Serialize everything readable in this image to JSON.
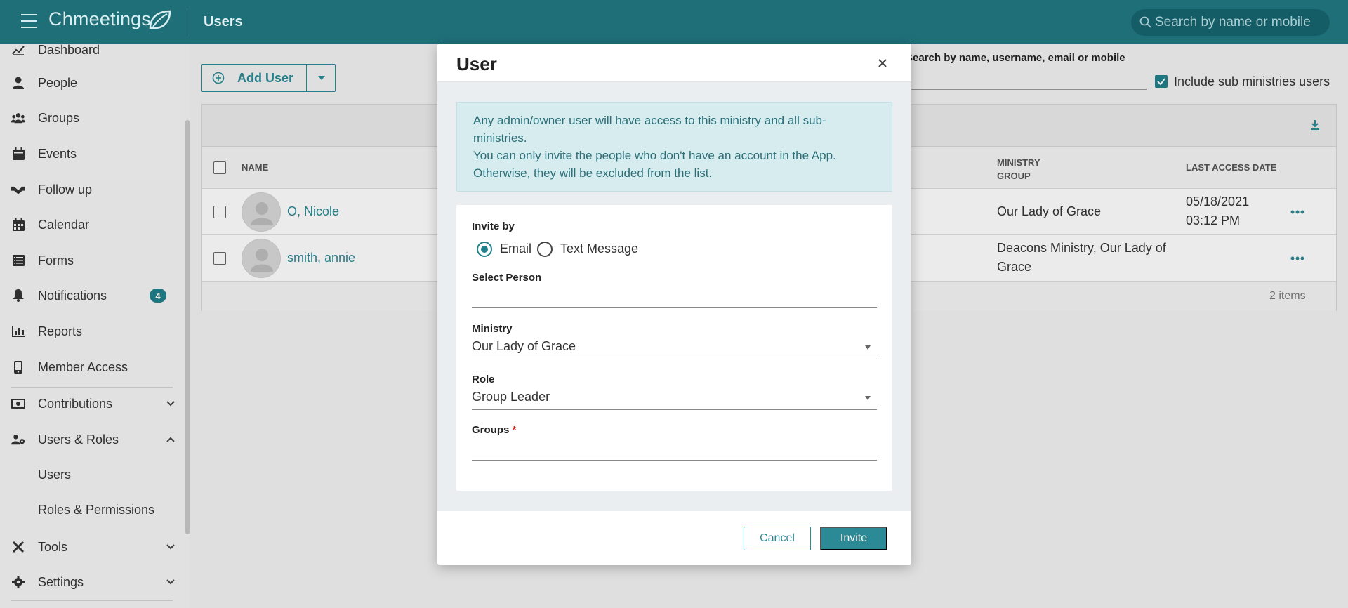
{
  "app": {
    "brand": "Chmeetings",
    "page_title": "Users",
    "search_placeholder": "Search by name or mobile"
  },
  "sidebar": {
    "items": [
      {
        "label": "Dashboard",
        "icon": "chart-icon"
      },
      {
        "label": "People",
        "icon": "person-icon"
      },
      {
        "label": "Groups",
        "icon": "users-icon"
      },
      {
        "label": "Events",
        "icon": "calendar-icon"
      },
      {
        "label": "Follow up",
        "icon": "handshake-icon"
      },
      {
        "label": "Calendar",
        "icon": "calendar-grid-icon"
      },
      {
        "label": "Forms",
        "icon": "list-icon"
      },
      {
        "label": "Notifications",
        "icon": "bell-icon",
        "badge": "4"
      },
      {
        "label": "Reports",
        "icon": "bar-chart-icon"
      },
      {
        "label": "Member Access",
        "icon": "mobile-icon"
      },
      {
        "label": "Contributions",
        "icon": "money-icon"
      },
      {
        "label": "Users & Roles",
        "icon": "users-cog-icon"
      },
      {
        "label": "Users"
      },
      {
        "label": "Roles & Permissions"
      },
      {
        "label": "Tools",
        "icon": "tools-icon"
      },
      {
        "label": "Settings",
        "icon": "gear-icon"
      }
    ]
  },
  "users_page": {
    "add_user_label": "Add User",
    "search_label": "Search by name, username, email or mobile",
    "include_sub_label": "Include sub ministries users",
    "columns": {
      "name": "NAME",
      "ministry_group": "MINISTRY GROUP",
      "last_access": "LAST ACCESS DATE"
    },
    "rows": [
      {
        "name": "O, Nicole",
        "ministry_group": "Our Lady of Grace",
        "last_access_date": "05/18/2021",
        "last_access_time": "03:12 PM"
      },
      {
        "name": "smith, annie",
        "ministry_group_1": "Deacons Ministry, Our Lady of",
        "ministry_group_2": "Grace",
        "last_access_date": "",
        "last_access_time": ""
      }
    ],
    "items_count": "2 items"
  },
  "modal": {
    "title": "User",
    "alert_line1": "Any admin/owner user will have access to this ministry and all sub-",
    "alert_line2": "ministries.",
    "alert_line3": "You can only invite the people who don't have an account in the App.",
    "alert_line4": "Otherwise, they will be excluded from the list.",
    "invite_by_label": "Invite by",
    "option_email": "Email",
    "option_text": "Text Message",
    "select_person_label": "Select Person",
    "select_person_value": "",
    "ministry_label": "Ministry",
    "ministry_value": "Our Lady of Grace",
    "role_label": "Role",
    "role_value": "Group Leader",
    "groups_label": "Groups",
    "required_mark": "*",
    "cancel_label": "Cancel",
    "invite_label": "Invite"
  },
  "colors": {
    "topbar": "#1f6f79",
    "accent": "#2b8a95",
    "alert_bg": "#d6ecef"
  }
}
